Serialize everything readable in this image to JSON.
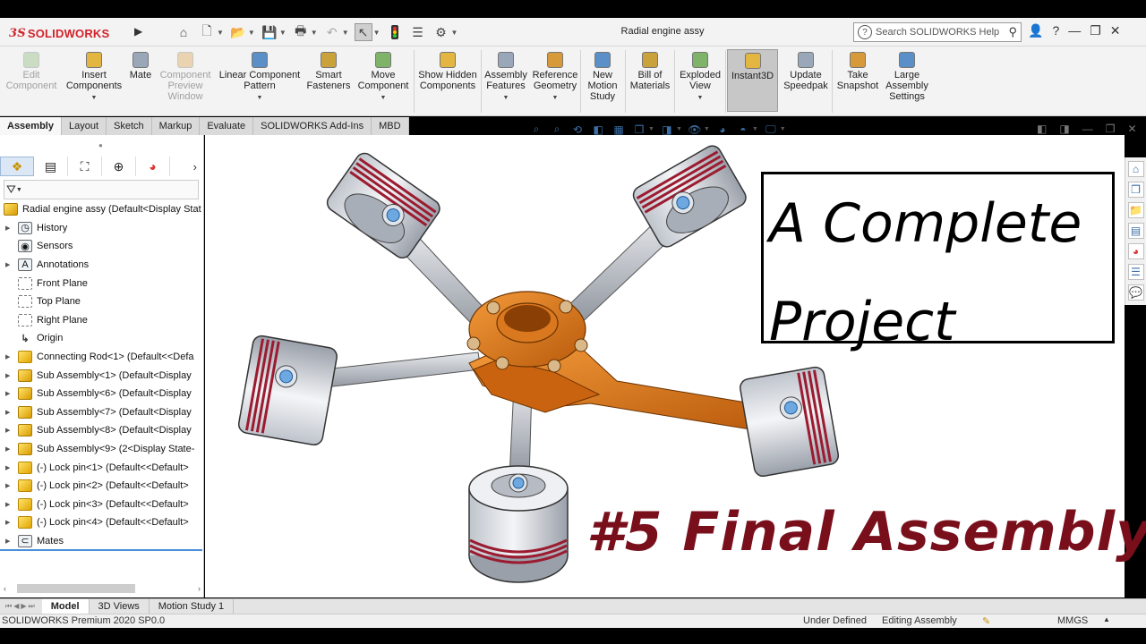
{
  "app": {
    "brand": "SOLIDWORKS",
    "document_title": "Radial engine assy",
    "search_placeholder": "Search SOLIDWORKS Help",
    "help_label": "?"
  },
  "ribbon": [
    {
      "id": "edit-component",
      "label": "Edit Component",
      "icon": "edit-component-icon",
      "disabled": true
    },
    {
      "id": "insert-components",
      "label": "Insert Components",
      "icon": "insert-components-icon",
      "dropdown": true
    },
    {
      "id": "mate",
      "label": "Mate",
      "icon": "paperclip-icon"
    },
    {
      "id": "component-preview",
      "label": "Component Preview Window",
      "icon": "preview-window-icon",
      "disabled": true
    },
    {
      "id": "linear-pattern",
      "label": "Linear Component Pattern",
      "icon": "linear-pattern-icon",
      "dropdown": true
    },
    {
      "id": "smart-fasteners",
      "label": "Smart Fasteners",
      "icon": "fastener-icon"
    },
    {
      "id": "move-component",
      "label": "Move Component",
      "icon": "move-component-icon",
      "dropdown": true
    },
    {
      "id": "show-hidden",
      "label": "Show Hidden Components",
      "icon": "show-hidden-icon"
    },
    {
      "id": "assembly-features",
      "label": "Assembly Features",
      "icon": "assembly-features-icon",
      "dropdown": true
    },
    {
      "id": "reference-geometry",
      "label": "Reference Geometry",
      "icon": "reference-geometry-icon",
      "dropdown": true
    },
    {
      "id": "new-motion-study",
      "label": "New Motion Study",
      "icon": "motion-study-icon"
    },
    {
      "id": "bill-of-materials",
      "label": "Bill of Materials",
      "icon": "bom-icon"
    },
    {
      "id": "exploded-view",
      "label": "Exploded View",
      "icon": "exploded-view-icon",
      "dropdown": true
    },
    {
      "id": "instant3d",
      "label": "Instant3D",
      "icon": "instant3d-icon",
      "active": true
    },
    {
      "id": "update-speedpak",
      "label": "Update Speedpak",
      "icon": "speedpak-icon"
    },
    {
      "id": "take-snapshot",
      "label": "Take Snapshot",
      "icon": "camera-icon"
    },
    {
      "id": "large-assembly",
      "label": "Large Assembly Settings",
      "icon": "large-assembly-icon"
    }
  ],
  "command_tabs": [
    "Assembly",
    "Layout",
    "Sketch",
    "Markup",
    "Evaluate",
    "SOLIDWORKS Add-Ins",
    "MBD"
  ],
  "tree": {
    "root": "Radial engine assy  (Default<Display Stat",
    "items": [
      {
        "label": "History",
        "icon": "history-folder-icon",
        "expand": true
      },
      {
        "label": "Sensors",
        "icon": "sensors-folder-icon",
        "expand": false
      },
      {
        "label": "Annotations",
        "icon": "annotations-icon",
        "expand": true
      },
      {
        "label": "Front Plane",
        "icon": "plane-icon",
        "expand": false
      },
      {
        "label": "Top Plane",
        "icon": "plane-icon",
        "expand": false
      },
      {
        "label": "Right Plane",
        "icon": "plane-icon",
        "expand": false
      },
      {
        "label": "Origin",
        "icon": "origin-icon",
        "expand": false
      },
      {
        "label": "Connecting Rod<1> (Default<<Defa",
        "icon": "part-icon",
        "expand": true
      },
      {
        "label": "Sub Assembly<1> (Default<Display",
        "icon": "subassembly-icon",
        "expand": true
      },
      {
        "label": "Sub Assembly<6> (Default<Display",
        "icon": "subassembly-icon",
        "expand": true
      },
      {
        "label": "Sub Assembly<7> (Default<Display",
        "icon": "subassembly-icon",
        "expand": true
      },
      {
        "label": "Sub Assembly<8> (Default<Display",
        "icon": "subassembly-icon",
        "expand": true
      },
      {
        "label": "Sub Assembly<9> (2<Display State-",
        "icon": "subassembly-icon",
        "expand": true
      },
      {
        "label": "(-) Lock pin<1> (Default<<Default>",
        "icon": "part-icon",
        "expand": true
      },
      {
        "label": "(-) Lock pin<2> (Default<<Default>",
        "icon": "part-icon",
        "expand": true
      },
      {
        "label": "(-) Lock pin<3> (Default<<Default>",
        "icon": "part-icon",
        "expand": true
      },
      {
        "label": "(-) Lock pin<4> (Default<<Default>",
        "icon": "part-icon",
        "expand": true
      },
      {
        "label": "Mates",
        "icon": "mates-icon",
        "expand": true
      }
    ]
  },
  "overlay": {
    "callout_line1": "A Complete",
    "callout_line2": "Project",
    "title": "#5 Final Assembly"
  },
  "model_tabs": [
    "Model",
    "3D Views",
    "Motion Study 1"
  ],
  "status": {
    "product": "SOLIDWORKS Premium 2020 SP0.0",
    "state": "Under Defined",
    "mode": "Editing Assembly",
    "units": "MMGS"
  },
  "colors": {
    "brand_red": "#d2232a",
    "crank_orange": "#e07a1a",
    "ring_red": "#9b1b30",
    "title_maroon": "#7a0f1c",
    "tab_active": "#f7f7f7"
  }
}
